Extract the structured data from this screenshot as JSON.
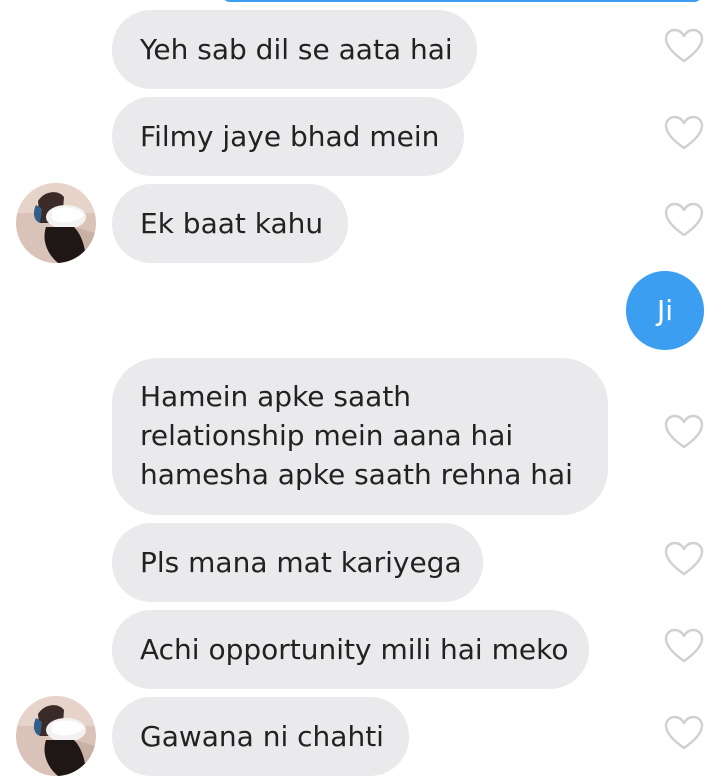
{
  "messages": [
    {
      "text": "Yeh sab dil se aata hai",
      "direction": "received"
    },
    {
      "text": "Filmy jaye bhad mein",
      "direction": "received"
    },
    {
      "text": "Ek baat kahu",
      "direction": "received",
      "avatar": "profile-photo"
    },
    {
      "text": "Ji",
      "direction": "sent"
    },
    {
      "text": "Hamein apke saath relationship mein aana hai hamesha apke saath rehna hai",
      "direction": "received"
    },
    {
      "text": "Pls mana mat kariyega",
      "direction": "received"
    },
    {
      "text": "Achi opportunity mili hai meko",
      "direction": "received"
    },
    {
      "text": "Gawana ni chahti",
      "direction": "received",
      "avatar": "profile-photo"
    }
  ],
  "icons": {
    "like": "heart-outline-icon"
  },
  "colors": {
    "received_bubble": "#eaeaec",
    "sent_bubble": "#3b9ef0",
    "received_text": "#222222",
    "sent_text": "#ffffff",
    "heart_outline": "#d0d0d4"
  }
}
